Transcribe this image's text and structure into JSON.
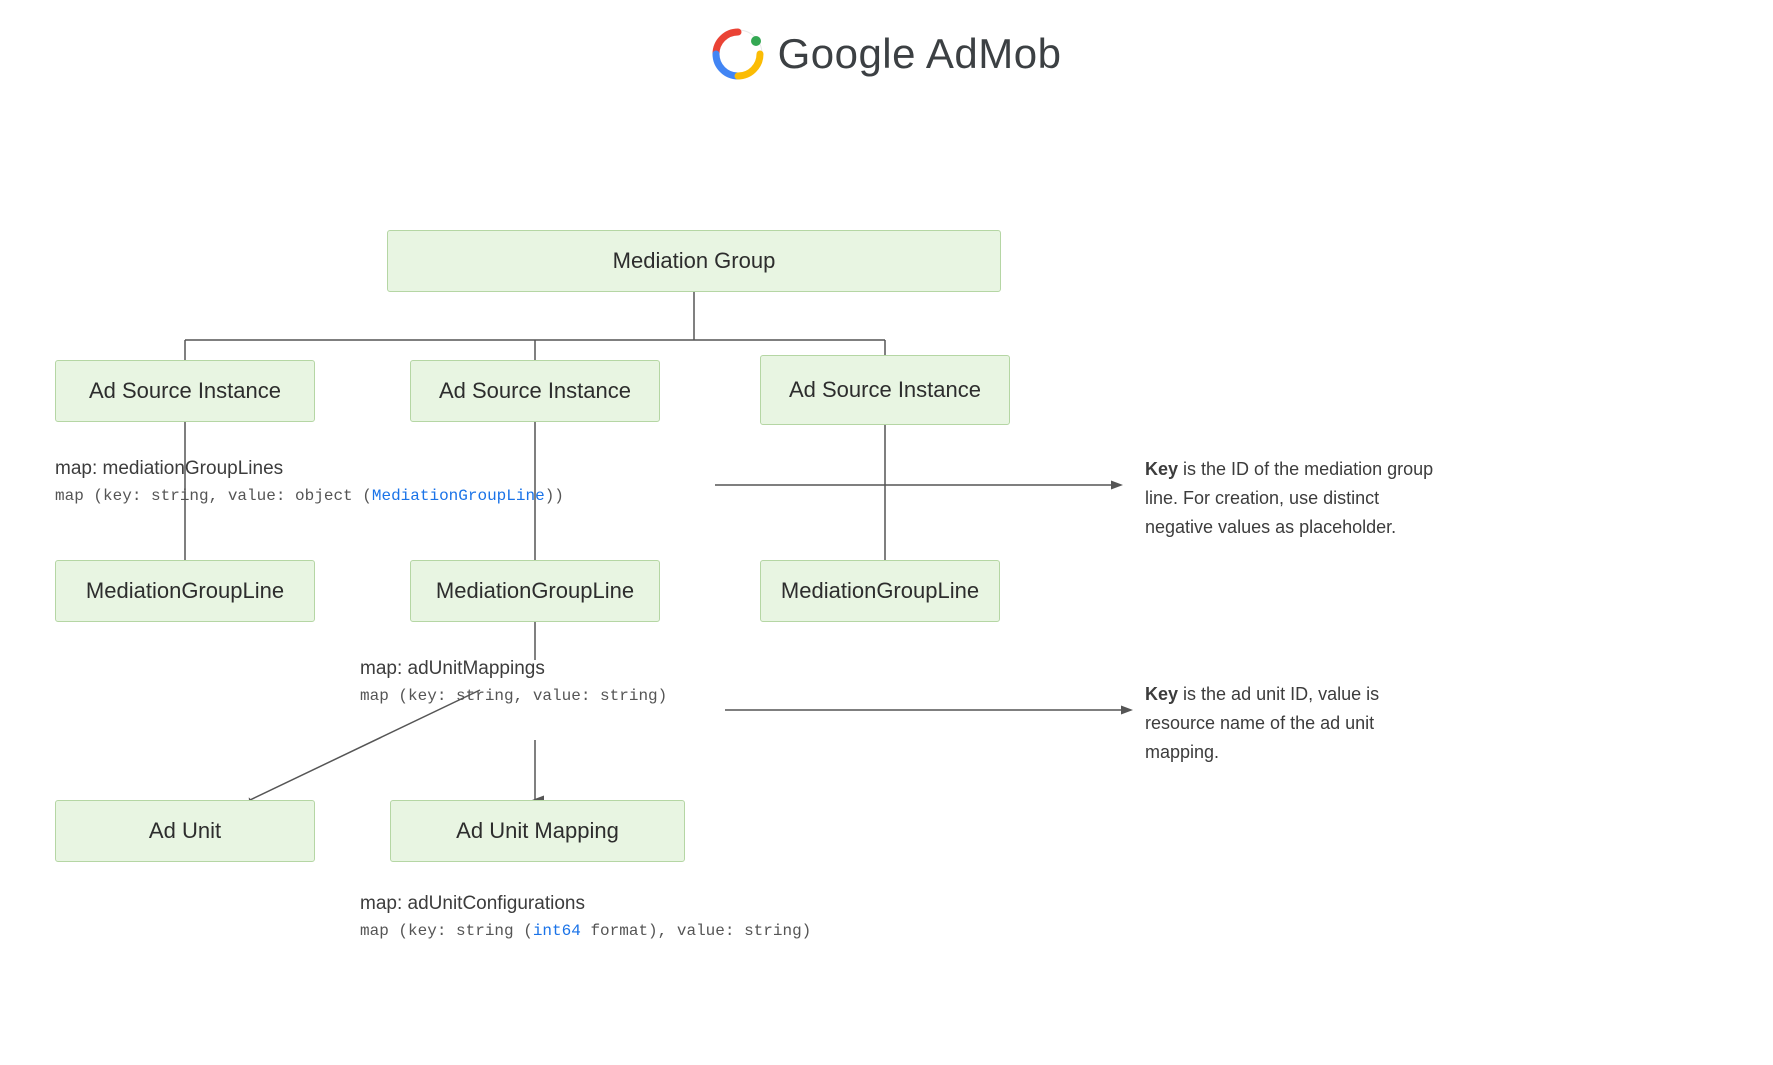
{
  "header": {
    "title": "Google AdMob"
  },
  "diagram": {
    "mediation_group": "Mediation Group",
    "ad_source_instance_1": "Ad Source Instance",
    "ad_source_instance_2": "Ad Source Instance",
    "ad_source_instance_3": "Ad Source Instance",
    "map_label_1_line1": "map: mediationGroupLines",
    "map_label_1_line2": "map (key: string, value: object (MediationGroupLine))",
    "mediation_group_line_1": "MediationGroupLine",
    "mediation_group_line_2": "MediationGroupLine",
    "mediation_group_line_3": "MediationGroupLine",
    "map_label_2_line1": "map: adUnitMappings",
    "map_label_2_line2": "map (key: string, value: string)",
    "ad_unit": "Ad Unit",
    "ad_unit_mapping": "Ad Unit Mapping",
    "map_label_3_line1": "map: adUnitConfigurations",
    "map_label_3_line2": "map (key: string (int64 format), value: string)",
    "note_1_bold": "Key",
    "note_1_rest": " is the ID of the mediation group line. For creation, use distinct negative values as placeholder.",
    "note_2_bold": "Key",
    "note_2_rest": " is the ad unit ID, value is resource name of the ad unit mapping."
  }
}
